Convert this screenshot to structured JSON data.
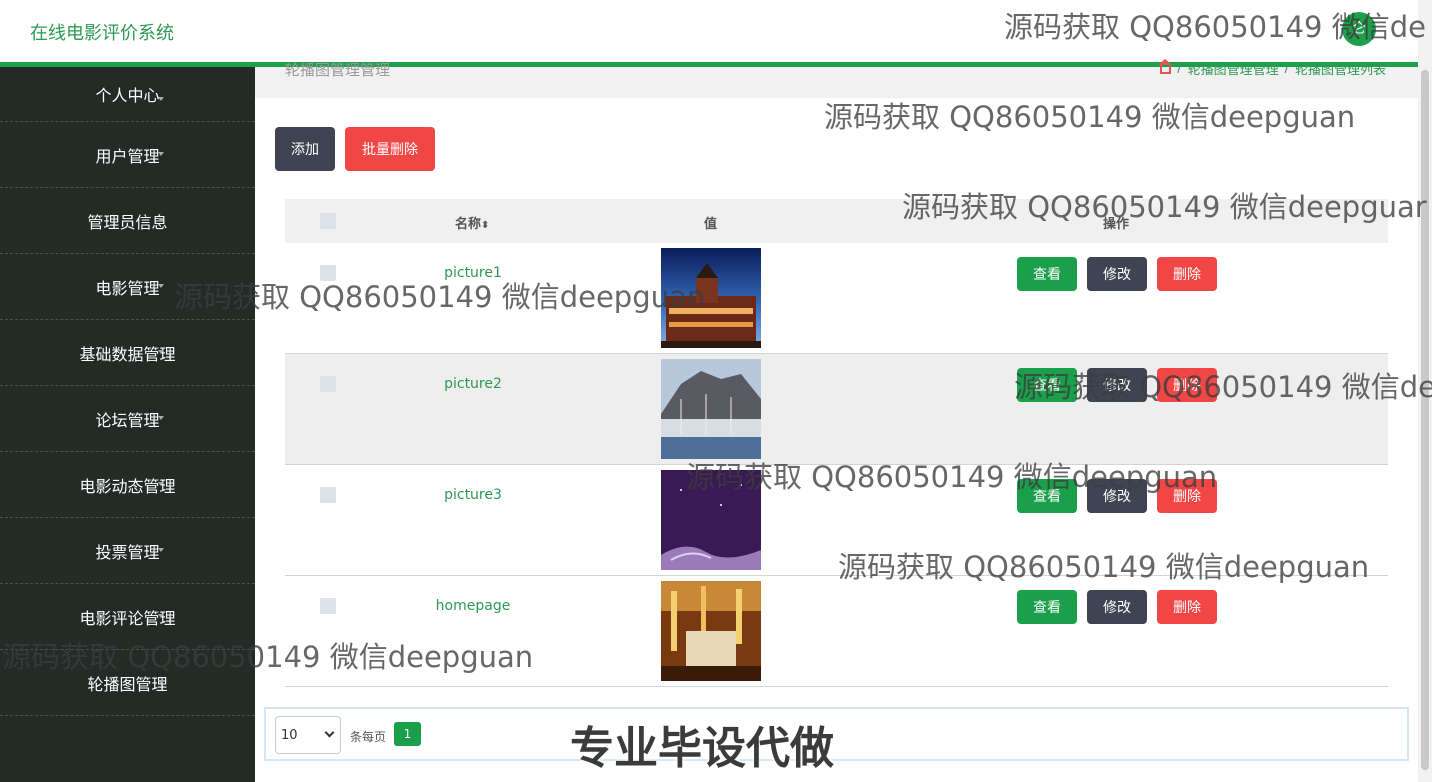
{
  "app": {
    "title": "在线电影评价系统",
    "avatar_label": "仑"
  },
  "sidebar": {
    "items": [
      {
        "label": "个人中心"
      },
      {
        "label": "用户管理"
      },
      {
        "label": "管理员信息"
      },
      {
        "label": "电影管理"
      },
      {
        "label": "基础数据管理"
      },
      {
        "label": "论坛管理"
      },
      {
        "label": "电影动态管理"
      },
      {
        "label": "投票管理"
      },
      {
        "label": "电影评论管理"
      },
      {
        "label": "轮播图管理"
      }
    ]
  },
  "breadcrumb": {
    "page_title": "轮播图管理管理",
    "crumb1": "轮播图管理管理",
    "crumb2": "轮播图管理列表",
    "sep": "/"
  },
  "toolbar": {
    "add_label": "添加",
    "batch_delete_label": "批量删除"
  },
  "table": {
    "headers": {
      "name": "名称",
      "sort_icon": "⬍",
      "value": "值",
      "actions": "操作"
    },
    "rows": [
      {
        "name": "picture1",
        "thumb": "castle-night"
      },
      {
        "name": "picture2",
        "thumb": "harbor-mountain"
      },
      {
        "name": "picture3",
        "thumb": "purple-night"
      },
      {
        "name": "homepage",
        "thumb": "warm-interior"
      }
    ],
    "actions": {
      "view": "查看",
      "edit": "修改",
      "delete": "删除"
    }
  },
  "pager": {
    "page_size": "10",
    "per_page_label": "条每页",
    "current_page": "1"
  },
  "watermarks": {
    "line": "源码获取 QQ86050149 微信deepguan",
    "line_cut1": "源码获取 QQ86050149 微信de",
    "line_cut2": "源码获取 QQ86050149 微信deepguar",
    "line_cut3": "源码获取 QQ86050149 微信de",
    "big": "专业毕设代做"
  },
  "colors": {
    "accent": "#1e9f4c",
    "danger": "#f04646",
    "dark": "#3e4451",
    "sidebar": "#232b27"
  }
}
